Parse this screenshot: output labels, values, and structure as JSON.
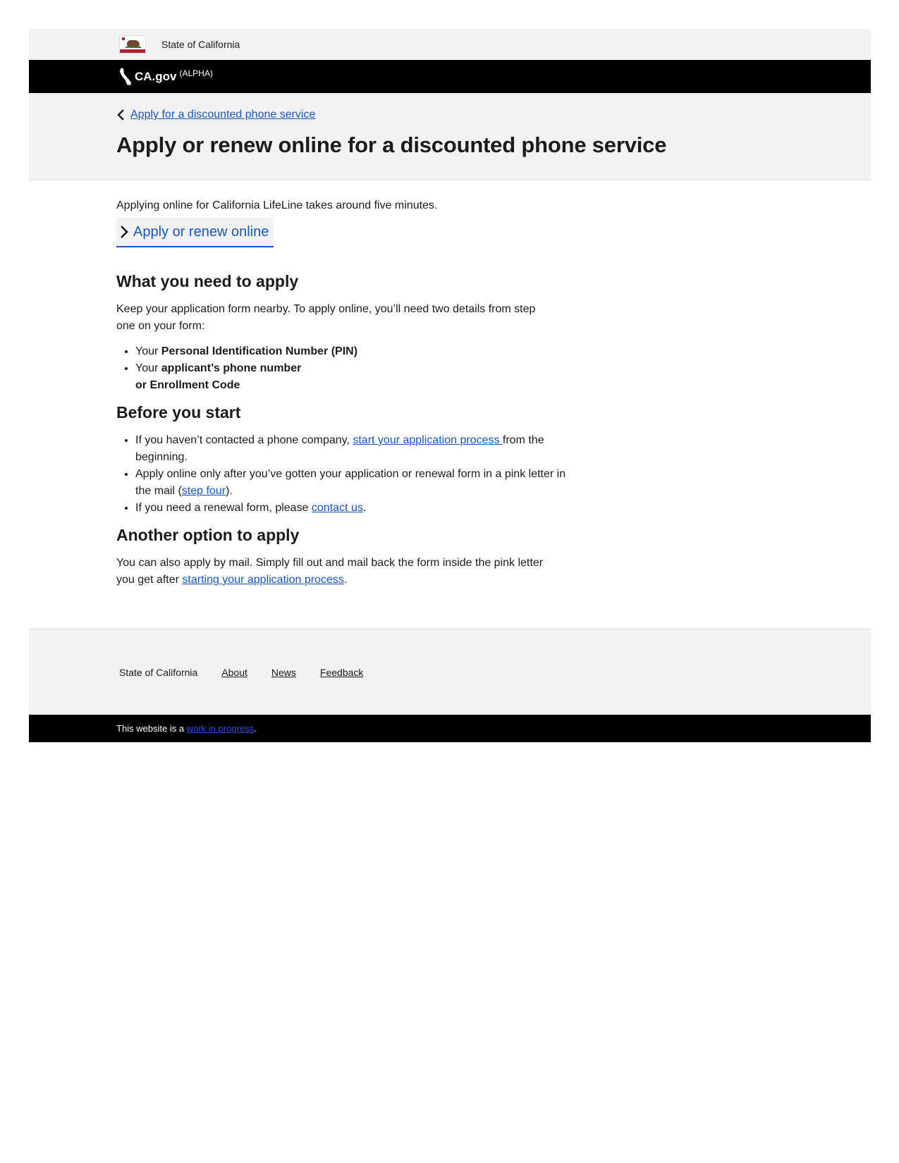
{
  "header": {
    "state_name": "State of California",
    "brand_name": "CA.gov",
    "brand_tag": "(ALPHA)"
  },
  "hero": {
    "breadcrumb_label": "Apply for a discounted phone service",
    "title": "Apply or renew online for a discounted phone service"
  },
  "intro": {
    "text": "Applying online for California LifeLine takes around five minutes.",
    "cta_label": "Apply or renew online"
  },
  "need_section": {
    "heading": "What you need to apply",
    "paragraph": "Keep your application form nearby. To apply online, you’ll need two details from step one on your form:",
    "items": [
      {
        "prefix": "Your ",
        "bold": "Personal Identification Number (PIN)"
      },
      {
        "prefix": "Your ",
        "bold": "applicant’s phone number",
        "bold2": "or Enrollment Code"
      }
    ]
  },
  "before_section": {
    "heading": "Before you start",
    "item1_prefix": "If you haven’t contacted a phone company, ",
    "item1_link": "start your application process ",
    "item1_suffix": "from the beginning.",
    "item2_prefix": "Apply online only after you’ve gotten your application or renewal form in a pink letter in the mail (",
    "item2_link": "step four",
    "item2_suffix": ").",
    "item3_prefix": "If you need a renewal form, please ",
    "item3_link": "contact us",
    "item3_suffix": "."
  },
  "another_section": {
    "heading": "Another option to apply",
    "prefix": "You can also apply by mail. Simply fill out and mail back the form inside the pink letter you get after ",
    "link": "starting your application process",
    "suffix": "."
  },
  "footer": {
    "state_name": "State of California",
    "links": [
      "About",
      "News",
      "Feedback"
    ]
  },
  "bottom": {
    "prefix": "This website is a ",
    "link": "work in progress",
    "suffix": "."
  },
  "colors": {
    "link": "#1a56b8",
    "bar": "#000000",
    "panel": "#f2f2f2"
  }
}
